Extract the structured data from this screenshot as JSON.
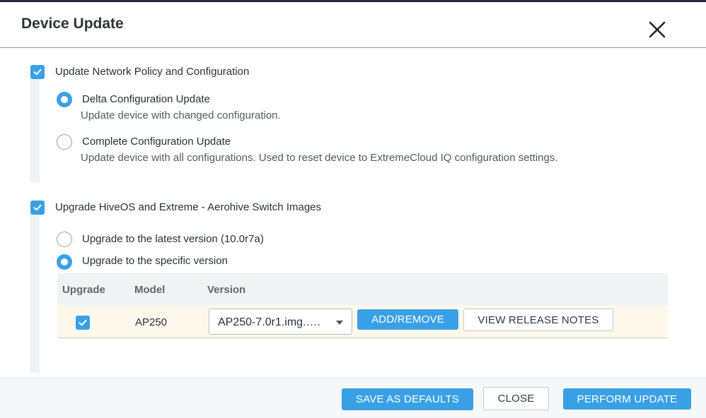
{
  "dialog": {
    "title": "Device Update"
  },
  "section_config": {
    "label": "Update Network Policy and Configuration",
    "checked": true,
    "options": [
      {
        "label": "Delta Configuration Update",
        "description": "Update device with changed configuration.",
        "selected": true
      },
      {
        "label": "Complete Configuration Update",
        "description": "Update device with all configurations. Used to reset device to ExtremeCloud IQ configuration settings.",
        "selected": false
      }
    ]
  },
  "section_upgrade": {
    "label": "Upgrade HiveOS and Extreme - Aerohive Switch Images",
    "checked": true,
    "options": [
      {
        "label": "Upgrade to the latest version (10.0r7a)",
        "selected": false
      },
      {
        "label": "Upgrade to the specific version",
        "selected": true
      }
    ],
    "table": {
      "headers": {
        "upgrade": "Upgrade",
        "model": "Model",
        "version": "Version"
      },
      "rows": [
        {
          "checked": true,
          "model": "AP250",
          "version": "AP250-7.0r1.img.…."
        }
      ],
      "add_remove_label": "ADD/REMOVE",
      "release_notes_label": "VIEW RELEASE NOTES"
    }
  },
  "footer": {
    "save_defaults_label": "SAVE AS DEFAULTS",
    "close_label": "CLOSE",
    "perform_label": "PERFORM UPDATE"
  },
  "colors": {
    "accent": "#3aa0e6",
    "top_bar": "#2b2240",
    "row_highlight": "#fdf8ec"
  },
  "icons": [
    "close-icon",
    "checkmark-icon",
    "chevron-down-icon"
  ]
}
